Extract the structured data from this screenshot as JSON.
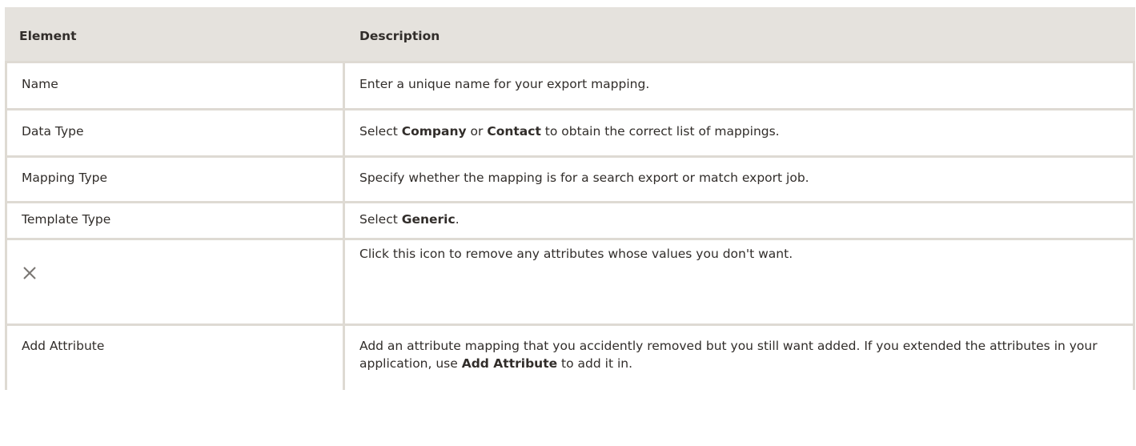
{
  "table": {
    "headers": {
      "element": "Element",
      "description": "Description"
    },
    "rows": [
      {
        "element": "Name",
        "description": [
          "Enter a unique name for your export mapping."
        ]
      },
      {
        "element": "Data Type",
        "description": [
          "Select ",
          "Company",
          " or ",
          "Contact",
          " to obtain the correct list of mappings."
        ]
      },
      {
        "element": "Mapping Type",
        "description": [
          "Specify whether the mapping is for a search export or match export job."
        ]
      },
      {
        "element": "Template Type",
        "description": [
          "Select ",
          "Generic",
          "."
        ]
      },
      {
        "element_icon": "close-icon",
        "description": [
          "Click this icon to remove any attributes whose values you don't want."
        ]
      },
      {
        "element": "Add Attribute",
        "description": [
          "Add an attribute mapping that you accidently removed but you still want added. If you extended the attributes in your application, use ",
          "Add Attribute",
          " to add it in."
        ]
      }
    ]
  },
  "colors": {
    "header_bg": "#e5e2dd",
    "border": "#dedad3",
    "text": "#312d2a",
    "icon": "#7a7672"
  }
}
